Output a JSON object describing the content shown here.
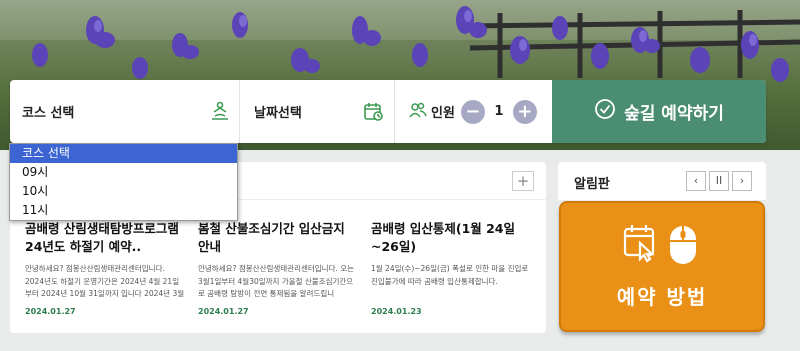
{
  "search": {
    "course_label": "코스 선택",
    "date_label": "날짜선택",
    "people_label": "인원",
    "people_count": "1",
    "minus": "−",
    "plus": "+",
    "submit_label": "숲길 예약하기"
  },
  "dropdown": {
    "options": [
      "코스 선택",
      "09시",
      "10시",
      "11시"
    ],
    "selected": "코스 선택"
  },
  "news": {
    "more": "+",
    "items": [
      {
        "title": "곰배령 산림생태탐방프로그램 24년도 하절기 예약..",
        "desc": "안녕하세요? 점봉산산림생태관리센터입니다. 2024년도 하절기 운영기간은 2024년 4월 21일부터 2024년 10월 31일까지 입니다 2024년 3월",
        "date": "2024.01.27"
      },
      {
        "title": "봄철 산불조심기간 입산금지 안내",
        "desc": "안녕하세요? 점봉산산림생태관리센터입니다. 오는 3월1일부터 4월30일까지 가을철 산불조심기간으로 곰배령 탐방이 전면 통제됨을 알려드립니",
        "date": "2024.01.27"
      },
      {
        "title": "곰배령 입산통제(1월 24일~26일)",
        "desc": "1월 24일(수)~26일(금) 폭설로 인한 마을 진입로 진입불가에 따라 곰배령 입산통제합니다.",
        "date": "2024.01.23"
      }
    ]
  },
  "board": {
    "title": "알림판",
    "prev": "‹",
    "pause": "II",
    "next": "›",
    "howto_label": "예약 방법"
  },
  "colors": {
    "accent_green": "#4b8d72",
    "orange": "#ea9016",
    "select_blue": "#3c64d2"
  }
}
